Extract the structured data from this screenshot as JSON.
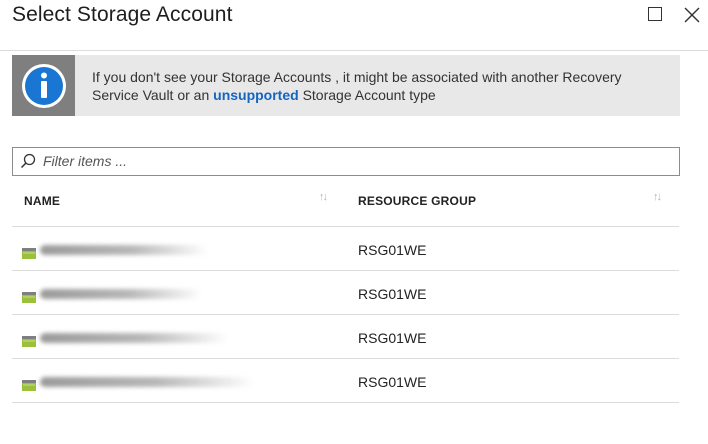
{
  "header": {
    "title": "Select Storage Account"
  },
  "info": {
    "text_before": "If you don't see your Storage Accounts , it might be associated with another Recovery Service Vault or an ",
    "link": "unsupported",
    "text_after": " Storage Account type"
  },
  "filter": {
    "placeholder": "Filter items ...",
    "value": ""
  },
  "table": {
    "columns": [
      "NAME",
      "RESOURCE GROUP"
    ],
    "rows": [
      {
        "resource_group": "RSG01WE"
      },
      {
        "resource_group": "RSG01WE"
      },
      {
        "resource_group": "RSG01WE"
      },
      {
        "resource_group": "RSG01WE"
      }
    ]
  },
  "icons": {
    "info": "info-circle-icon",
    "search": "search-icon",
    "maximize": "maximize-icon",
    "close": "close-icon",
    "storage": "storage-account-icon",
    "sort": "sort-arrows-icon"
  },
  "colors": {
    "accent_link": "#1565c0",
    "info_icon": "#1976d2",
    "banner_bg": "#e8e8e8",
    "storage_icon_green": "#9bc13c"
  }
}
